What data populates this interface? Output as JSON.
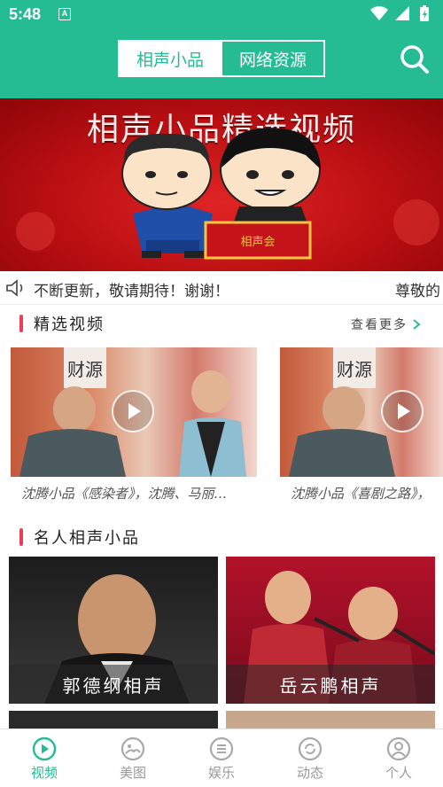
{
  "status_bar": {
    "time": "5:48",
    "notification_letter": "A"
  },
  "header": {
    "tabs": [
      {
        "label": "相声小品",
        "active": true
      },
      {
        "label": "网络资源",
        "active": false
      }
    ],
    "search_icon": "search-icon"
  },
  "banner": {
    "title": "相声小品精选视频",
    "sign_text": "相声会"
  },
  "notice": {
    "text": "不断更新，敬请期待！谢谢！",
    "text_continued": "尊敬的"
  },
  "featured": {
    "title": "精选视频",
    "more_label": "查看更多",
    "videos": [
      {
        "caption": "沈腾小品《感染者》，沈腾、马丽…",
        "poster_text": "财源"
      },
      {
        "caption": "沈腾小品《喜剧之路》，",
        "poster_text": "财源"
      }
    ]
  },
  "celebrities": {
    "title": "名人相声小品",
    "cards": [
      {
        "label": "郭德纲相声"
      },
      {
        "label": "岳云鹏相声"
      }
    ]
  },
  "tabbar": {
    "items": [
      {
        "label": "视频",
        "icon": "play-icon",
        "active": true
      },
      {
        "label": "美图",
        "icon": "image-icon",
        "active": false
      },
      {
        "label": "娱乐",
        "icon": "list-icon",
        "active": false
      },
      {
        "label": "动态",
        "icon": "refresh-icon",
        "active": false
      },
      {
        "label": "个人",
        "icon": "person-icon",
        "active": false
      }
    ]
  },
  "colors": {
    "accent": "#25bc94",
    "section_bar": "#e8405a",
    "banner_red": "#c01518"
  }
}
